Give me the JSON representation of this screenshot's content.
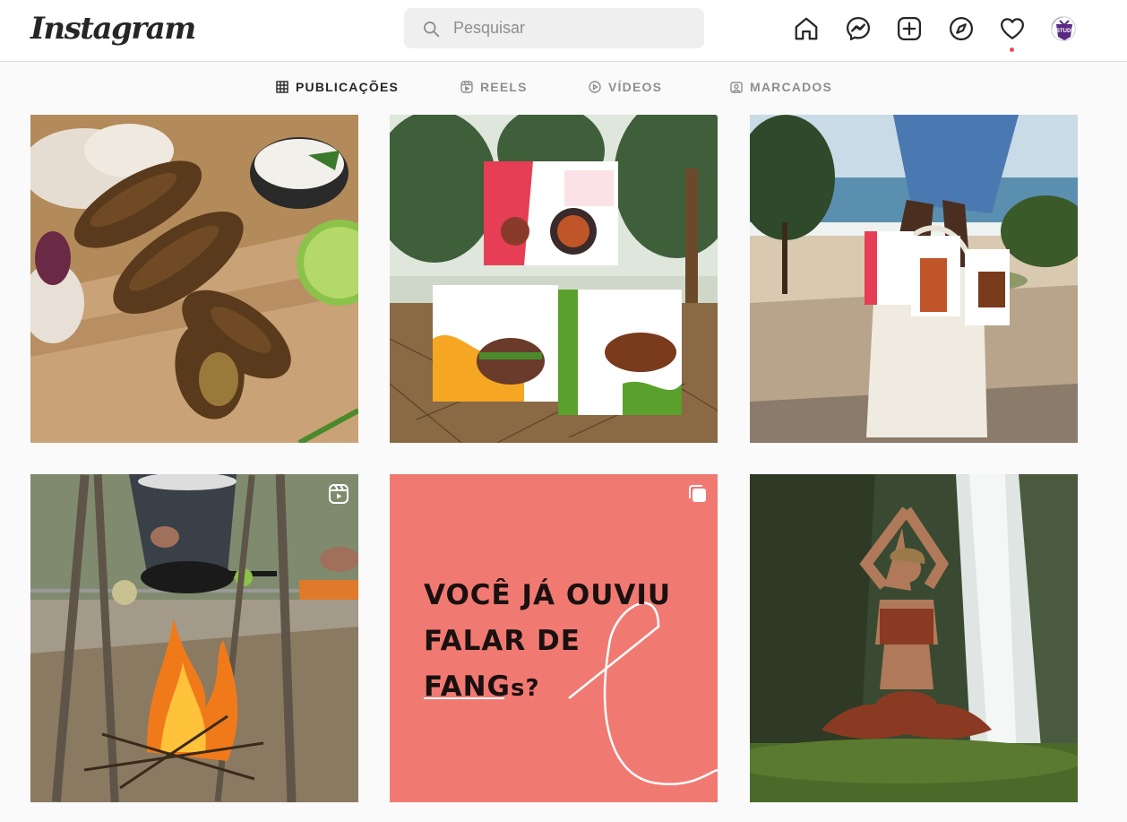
{
  "header": {
    "logo_text": "Instagram",
    "search_placeholder": "Pesquisar",
    "icons": [
      "home-icon",
      "messenger-icon",
      "new-post-icon",
      "explore-icon",
      "activity-heart-icon"
    ],
    "avatar_text": "STUDI",
    "notification_dot_color": "#ed4956"
  },
  "tabs": [
    {
      "label": "PUBLICAÇÕES",
      "icon": "grid-icon",
      "active": true
    },
    {
      "label": "REELS",
      "icon": "reels-icon",
      "active": false
    },
    {
      "label": "VÍDEOS",
      "icon": "video-play-icon",
      "active": false
    },
    {
      "label": "MARCADOS",
      "icon": "tagged-icon",
      "active": false
    }
  ],
  "posts": [
    {
      "subject": "fried shimeji kibe croquettes with lime and dip",
      "badge": null
    },
    {
      "subject": "Cogodo product boxes: Bolinho de Shimeji Recheado com cream cheese, Hambúrguer de Shimeji, Kibe de Shimeji"
    },
    {
      "subject": "person carrying tote bag with Cogodo boxes on beach"
    },
    {
      "subject": "cooking over campfire with iron skillet",
      "badge": "reels-icon"
    },
    {
      "overlay_text": {
        "line1": "VOCÊ JÁ OUVIU",
        "line2": "FALAR DE",
        "line3_main": "FANG",
        "line3_suffix": "s?"
      },
      "background": "#f07a72",
      "badge": "carousel-icon"
    },
    {
      "subject": "woman meditating in front of waterfall"
    }
  ],
  "colors": {
    "accent": "#262626",
    "muted": "#8e8e8e",
    "border": "#dbdbdb",
    "post5_bg": "#f07a72"
  }
}
